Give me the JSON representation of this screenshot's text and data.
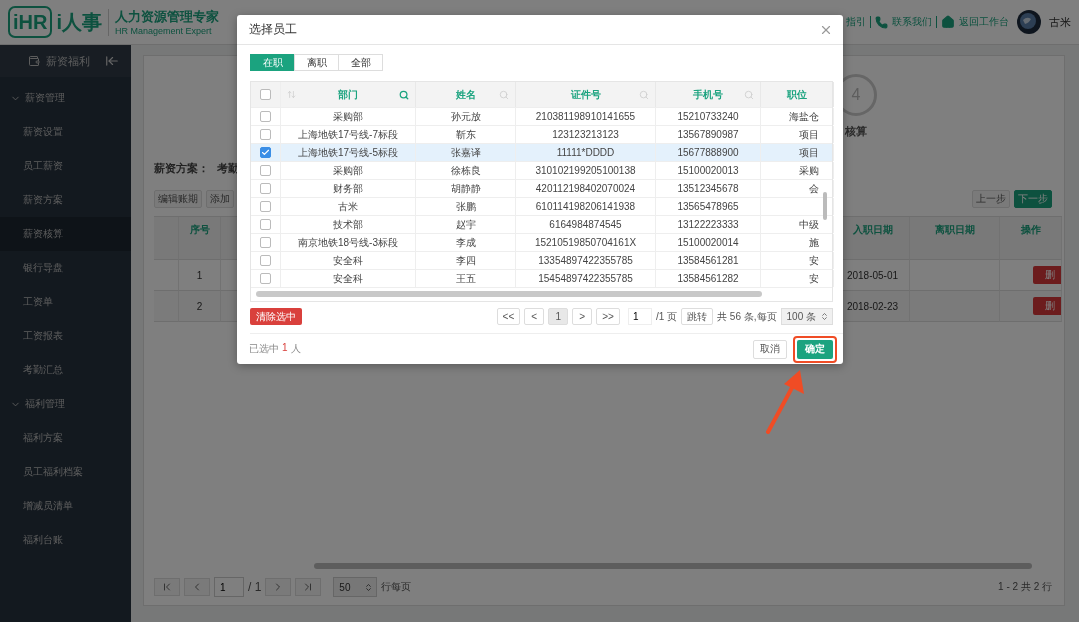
{
  "header": {
    "logo_mark": "iHR",
    "logo_text": "i人事",
    "title": "人力资源管理专家",
    "subtitle": "HR Management Expert",
    "links": [
      {
        "kind": "text",
        "label": "指引"
      },
      {
        "kind": "phone",
        "label": "联系我们"
      },
      {
        "kind": "home",
        "label": "返回工作台"
      }
    ],
    "user": "古米"
  },
  "sidebar": {
    "module": "薪资福利",
    "groups": [
      {
        "label": "薪资管理",
        "expanded": true,
        "children": [
          {
            "label": "薪资设置",
            "selected": false
          },
          {
            "label": "员工薪资",
            "selected": false
          },
          {
            "label": "薪资方案",
            "selected": false
          },
          {
            "label": "薪资核算",
            "selected": true
          },
          {
            "label": "银行导盘",
            "selected": false
          },
          {
            "label": "工资单",
            "selected": false
          },
          {
            "label": "工资报表",
            "selected": false
          },
          {
            "label": "考勤汇总",
            "selected": false
          }
        ]
      },
      {
        "label": "福利管理",
        "expanded": true,
        "children": [
          {
            "label": "福利方案",
            "selected": false
          },
          {
            "label": "员工福利档案",
            "selected": false
          },
          {
            "label": "增减员清单",
            "selected": false
          },
          {
            "label": "福利台账",
            "selected": false
          }
        ]
      }
    ]
  },
  "main": {
    "step": {
      "number": "4",
      "label": "核算"
    },
    "scheme_label": "薪资方案：",
    "scheme_value": "考勤",
    "toolbar_left": [
      "编辑账期",
      "添加"
    ],
    "toolbar_right": [
      {
        "label": "上一步",
        "primary": false
      },
      {
        "label": "下一步",
        "primary": true
      }
    ],
    "table": {
      "columns": [
        "序号",
        "入职日期",
        "离职日期",
        "操作"
      ],
      "rows": [
        {
          "index": "1",
          "hire_date": "2018-05-01",
          "action": "删"
        },
        {
          "index": "2",
          "hire_date": "2018-02-23",
          "action": "删"
        }
      ]
    },
    "pager": {
      "page": "1",
      "total": "/ 1",
      "page_size": "50",
      "page_size_label": "行每页",
      "summary": "1 - 2 共 2 行"
    }
  },
  "modal": {
    "title": "选择员工",
    "tabs": [
      {
        "label": "在职",
        "selected": true
      },
      {
        "label": "离职",
        "selected": false
      },
      {
        "label": "全部",
        "selected": false
      }
    ],
    "columns": [
      {
        "label": "部门",
        "filter_active": true
      },
      {
        "label": "姓名",
        "filter_active": false
      },
      {
        "label": "证件号",
        "filter_active": false
      },
      {
        "label": "手机号",
        "filter_active": false
      },
      {
        "label": "职位"
      }
    ],
    "all_checked": false,
    "rows": [
      {
        "checked": false,
        "cells": [
          "采购部",
          "孙元放",
          "210381198910141655",
          "15210733240",
          "海盐仓"
        ]
      },
      {
        "checked": false,
        "cells": [
          "上海地铁17号线-7标段",
          "靳东",
          "123123213123",
          "13567890987",
          "项目"
        ]
      },
      {
        "checked": true,
        "cells": [
          "上海地铁17号线-5标段",
          "张嘉译",
          "11111*DDDD",
          "15677888900",
          "项目"
        ]
      },
      {
        "checked": false,
        "cells": [
          "采购部",
          "徐栋良",
          "310102199205100138",
          "15100020013",
          "采购"
        ]
      },
      {
        "checked": false,
        "cells": [
          "财务部",
          "胡静静",
          "420112198402070024",
          "13512345678",
          "会"
        ]
      },
      {
        "checked": false,
        "cells": [
          "古米",
          "张鹏",
          "610114198206141938",
          "13565478965",
          ""
        ]
      },
      {
        "checked": false,
        "cells": [
          "技术部",
          "赵宇",
          "6164984874545",
          "13122223333",
          "中级"
        ]
      },
      {
        "checked": false,
        "cells": [
          "南京地铁18号线-3标段",
          "李成",
          "15210519850704161X",
          "15100020014",
          "施"
        ]
      },
      {
        "checked": false,
        "cells": [
          "安全科",
          "李四",
          "13354897422355785",
          "13584561281",
          "安"
        ]
      },
      {
        "checked": false,
        "cells": [
          "安全科",
          "王五",
          "15454897422355785",
          "13584561282",
          "安"
        ]
      }
    ],
    "clear_button": "清除选中",
    "pager": {
      "buttons": [
        {
          "label": "<<",
          "selected": false
        },
        {
          "label": "<",
          "selected": false
        },
        {
          "label": "1",
          "selected": true
        },
        {
          "label": ">",
          "selected": false
        },
        {
          "label": ">>",
          "selected": false
        }
      ],
      "jump_value": "1",
      "pages_label": "/1 页",
      "jump_button": "跳转",
      "total_label": "共 56 条,每页",
      "page_size": "100 条"
    },
    "footer": {
      "selected_prefix": "已选中",
      "selected_count": "1",
      "selected_suffix": "人",
      "cancel": "取消",
      "confirm": "确定"
    }
  }
}
